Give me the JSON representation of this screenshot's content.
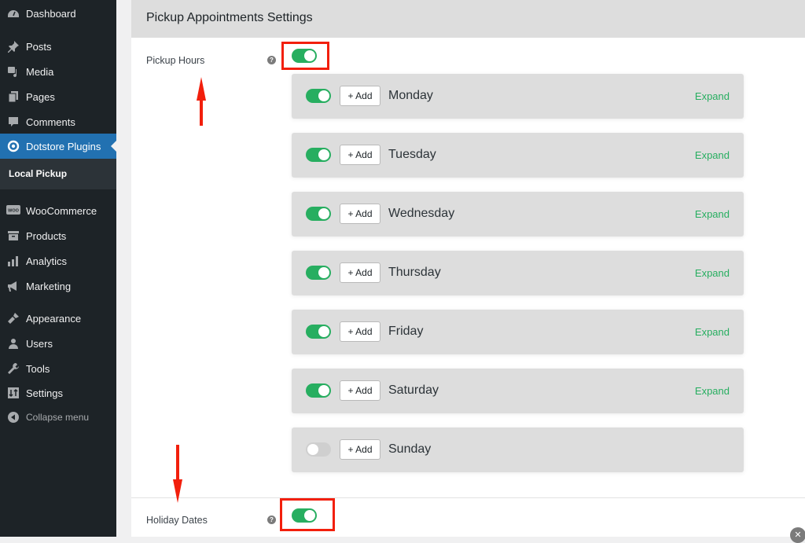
{
  "sidebar": {
    "items": [
      {
        "label": "Dashboard",
        "icon": "dashboard-icon"
      },
      {
        "label": "Posts",
        "icon": "pin-icon"
      },
      {
        "label": "Media",
        "icon": "media-icon"
      },
      {
        "label": "Pages",
        "icon": "pages-icon"
      },
      {
        "label": "Comments",
        "icon": "comment-icon"
      },
      {
        "label": "Dotstore Plugins",
        "icon": "target-icon",
        "active": true
      },
      {
        "label": "WooCommerce",
        "icon": "woo-icon"
      },
      {
        "label": "Products",
        "icon": "archive-icon"
      },
      {
        "label": "Analytics",
        "icon": "bar-chart-icon"
      },
      {
        "label": "Marketing",
        "icon": "megaphone-icon"
      },
      {
        "label": "Appearance",
        "icon": "brush-icon"
      },
      {
        "label": "Users",
        "icon": "user-icon"
      },
      {
        "label": "Tools",
        "icon": "wrench-icon"
      },
      {
        "label": "Settings",
        "icon": "settings-icon"
      },
      {
        "label": "Collapse menu",
        "icon": "collapse-icon"
      }
    ],
    "submenu": {
      "label": "Local Pickup"
    }
  },
  "main": {
    "title": "Pickup Appointments Settings",
    "pickup_hours": {
      "label": "Pickup Hours",
      "help": "?",
      "enabled": true
    },
    "days": [
      {
        "name": "Monday",
        "enabled": true,
        "add_label": "+ Add",
        "expand_label": "Expand"
      },
      {
        "name": "Tuesday",
        "enabled": true,
        "add_label": "+ Add",
        "expand_label": "Expand"
      },
      {
        "name": "Wednesday",
        "enabled": true,
        "add_label": "+ Add",
        "expand_label": "Expand"
      },
      {
        "name": "Thursday",
        "enabled": true,
        "add_label": "+ Add",
        "expand_label": "Expand"
      },
      {
        "name": "Friday",
        "enabled": true,
        "add_label": "+ Add",
        "expand_label": "Expand"
      },
      {
        "name": "Saturday",
        "enabled": true,
        "add_label": "+ Add",
        "expand_label": "Expand"
      },
      {
        "name": "Sunday",
        "enabled": false,
        "add_label": "+ Add",
        "expand_label": ""
      }
    ],
    "holiday_dates": {
      "label": "Holiday Dates",
      "help": "?",
      "enabled": true
    }
  },
  "colors": {
    "accent": "#27ae60",
    "sidebar_bg": "#1d2327",
    "active_bg": "#2271b1",
    "highlight": "#f21f0c"
  }
}
